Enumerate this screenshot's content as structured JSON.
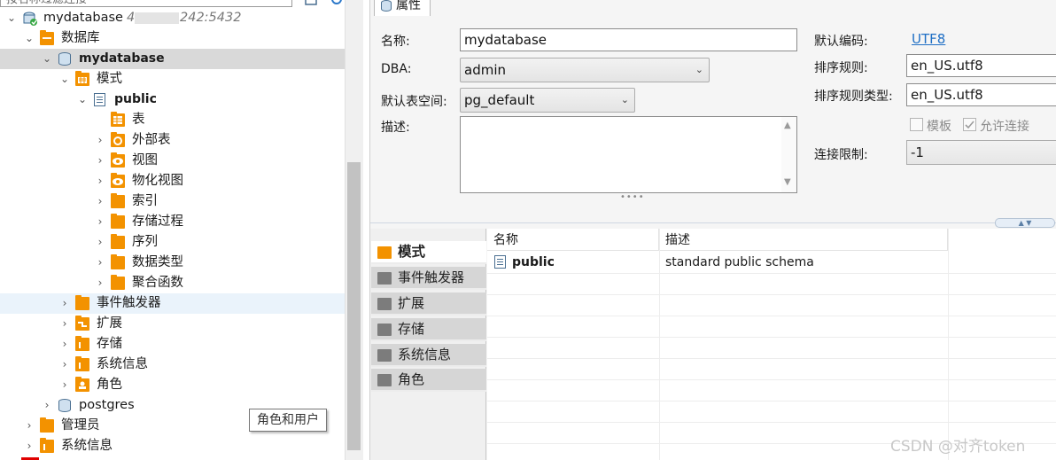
{
  "navigator": {
    "filter_placeholder": "按名称过滤连接",
    "tree": [
      {
        "label": "mydatabase",
        "suffix_left": "4",
        "suffix_right": "242:5432",
        "icon": "connection-icon"
      },
      {
        "label": "数据库",
        "icon": "folder-icon"
      },
      {
        "label": "mydatabase",
        "icon": "database-icon",
        "selected": true
      },
      {
        "label": "模式",
        "icon": "folder-icon"
      },
      {
        "label": "public",
        "icon": "schema-icon"
      },
      {
        "label": "表",
        "icon": "table-folder-icon"
      },
      {
        "label": "外部表",
        "icon": "folder-icon"
      },
      {
        "label": "视图",
        "icon": "view-folder-icon"
      },
      {
        "label": "物化视图",
        "icon": "view-folder-icon"
      },
      {
        "label": "索引",
        "icon": "folder-icon"
      },
      {
        "label": "存储过程",
        "icon": "folder-icon"
      },
      {
        "label": "序列",
        "icon": "folder-icon"
      },
      {
        "label": "数据类型",
        "icon": "folder-icon"
      },
      {
        "label": "聚合函数",
        "icon": "folder-icon"
      },
      {
        "label": "事件触发器",
        "icon": "folder-icon",
        "hover": true
      },
      {
        "label": "扩展",
        "icon": "folder-icon"
      },
      {
        "label": "存储",
        "icon": "folder-icon"
      },
      {
        "label": "系统信息",
        "icon": "folder-icon"
      },
      {
        "label": "角色",
        "icon": "folder-icon"
      },
      {
        "label": "postgres",
        "icon": "database-icon"
      },
      {
        "label": "管理员",
        "icon": "folder-icon"
      },
      {
        "label": "系统信息",
        "icon": "folder-icon"
      }
    ],
    "tooltip": "角色和用户"
  },
  "editor": {
    "tab_label": "属性",
    "form": {
      "name_label": "名称:",
      "name_value": "mydatabase",
      "dba_label": "DBA:",
      "dba_value": "admin",
      "tablespace_label": "默认表空间:",
      "tablespace_value": "pg_default",
      "description_label": "描述:",
      "description_value": "",
      "encoding_label": "默认编码:",
      "encoding_value": "UTF8",
      "collation_label": "排序规则:",
      "collation_value": "en_US.utf8",
      "ctype_label": "排序规则类型:",
      "ctype_value": "en_US.utf8",
      "template_label": "模板",
      "allow_conn_label": "允许连接",
      "template_checked": false,
      "allow_conn_checked": true,
      "conn_limit_label": "连接限制:",
      "conn_limit_value": "-1"
    },
    "side_tabs": [
      {
        "label": "模式",
        "icon": "schema-folder-icon",
        "active": true
      },
      {
        "label": "事件触发器",
        "icon": "folder-icon"
      },
      {
        "label": "扩展",
        "icon": "extension-icon"
      },
      {
        "label": "存储",
        "icon": "storage-icon"
      },
      {
        "label": "系统信息",
        "icon": "info-icon"
      },
      {
        "label": "角色",
        "icon": "role-icon"
      }
    ],
    "grid": {
      "columns": [
        "名称",
        "描述"
      ],
      "rows": [
        {
          "name": "public",
          "description": "standard public schema"
        }
      ]
    }
  },
  "watermark": "CSDN @对齐token",
  "colors": {
    "folder_orange": "#f39200",
    "selection_gray": "#d9d9d9",
    "hover_blue": "#eaf3fb",
    "link_blue": "#1f6fc5"
  }
}
